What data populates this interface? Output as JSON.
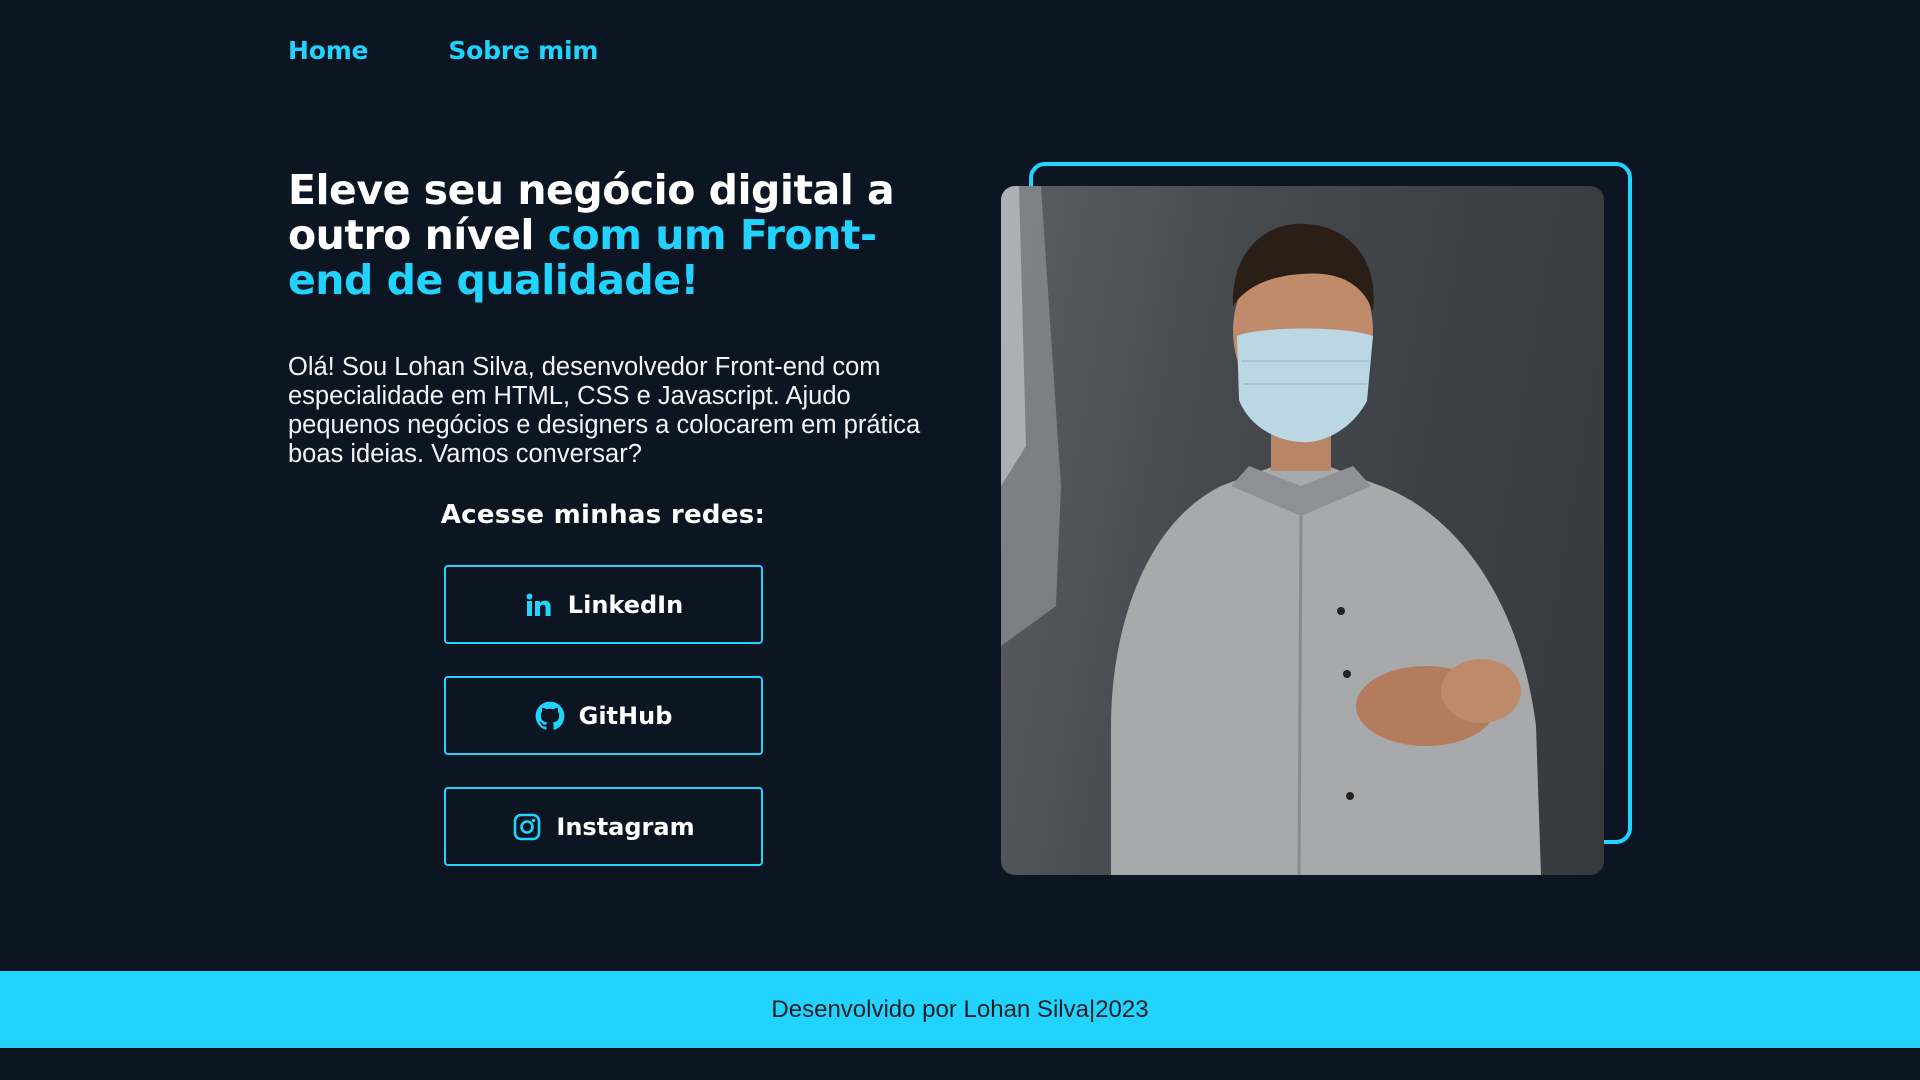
{
  "nav": {
    "items": [
      {
        "label": "Home"
      },
      {
        "label": "Sobre mim"
      }
    ]
  },
  "hero": {
    "headline_plain": "Eleve seu negócio digital a outro nível ",
    "headline_accent": "com um Front-end de qualidade!",
    "intro": "Olá! Sou Lohan Silva, desenvolvedor Front-end com especialidade em HTML, CSS e Javascript. Ajudo pequenos negócios e designers a colocarem em prática boas ideias. Vamos conversar?"
  },
  "networks": {
    "title": "Acesse minhas redes:",
    "buttons": [
      {
        "label": "LinkedIn",
        "icon": "linkedin-icon"
      },
      {
        "label": "GitHub",
        "icon": "github-icon"
      },
      {
        "label": "Instagram",
        "icon": "instagram-icon"
      }
    ]
  },
  "footer": {
    "text": "Desenvolvido por Lohan Silva|2023"
  },
  "colors": {
    "background": "#0b1622",
    "accent": "#22d3ff",
    "text": "#ffffff"
  }
}
